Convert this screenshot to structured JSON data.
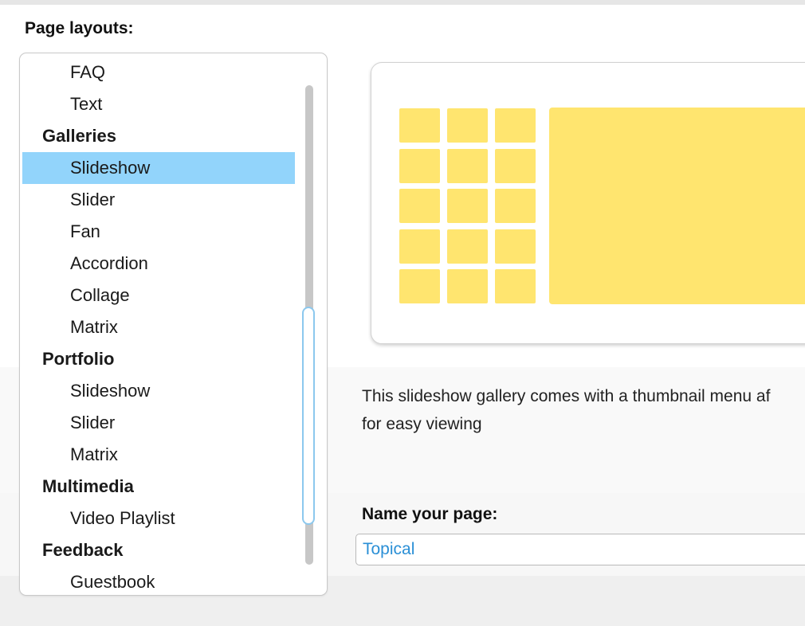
{
  "layouts_header": "Page layouts:",
  "layout_list": {
    "rows": [
      {
        "type": "item",
        "label": "FAQ",
        "selected": false
      },
      {
        "type": "item",
        "label": "Text",
        "selected": false
      },
      {
        "type": "group",
        "label": "Galleries"
      },
      {
        "type": "item",
        "label": "Slideshow",
        "selected": true
      },
      {
        "type": "item",
        "label": "Slider",
        "selected": false
      },
      {
        "type": "item",
        "label": "Fan",
        "selected": false
      },
      {
        "type": "item",
        "label": "Accordion",
        "selected": false
      },
      {
        "type": "item",
        "label": "Collage",
        "selected": false
      },
      {
        "type": "item",
        "label": "Matrix",
        "selected": false
      },
      {
        "type": "group",
        "label": "Portfolio"
      },
      {
        "type": "item",
        "label": "Slideshow",
        "selected": false
      },
      {
        "type": "item",
        "label": "Slider",
        "selected": false
      },
      {
        "type": "item",
        "label": "Matrix",
        "selected": false
      },
      {
        "type": "group",
        "label": "Multimedia"
      },
      {
        "type": "item",
        "label": "Video Playlist",
        "selected": false
      },
      {
        "type": "group",
        "label": "Feedback"
      },
      {
        "type": "item",
        "label": "Guestbook",
        "selected": false
      }
    ]
  },
  "preview": {
    "thumbnail_grid": {
      "columns": 3,
      "rows": 5
    }
  },
  "description": "This slideshow gallery comes with a thumbnail menu af\nfor easy viewing",
  "name_field": {
    "label": "Name your page:",
    "value": "Topical"
  },
  "colors": {
    "selection": "#92d4fb",
    "scroll_thumb_border": "#8cc8ee",
    "thumbnail": "#ffe56f",
    "input_text": "#2a8fd6"
  }
}
